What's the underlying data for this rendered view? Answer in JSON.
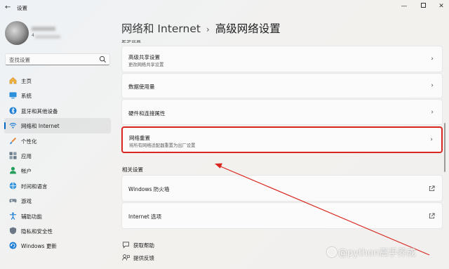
{
  "window": {
    "title": "设置",
    "back": "←",
    "minimize": "—",
    "close": "✕"
  },
  "user": {
    "email_prefix": "4"
  },
  "search": {
    "placeholder": "查找设置"
  },
  "sidebar": {
    "items": [
      {
        "label": "主页",
        "icon": "home-icon"
      },
      {
        "label": "系统",
        "icon": "system-icon"
      },
      {
        "label": "蓝牙和其他设备",
        "icon": "bluetooth-icon"
      },
      {
        "label": "网络和 Internet",
        "icon": "wifi-icon",
        "active": true
      },
      {
        "label": "个性化",
        "icon": "brush-icon"
      },
      {
        "label": "应用",
        "icon": "apps-icon"
      },
      {
        "label": "帐户",
        "icon": "account-icon"
      },
      {
        "label": "时间和语言",
        "icon": "globe-clock-icon"
      },
      {
        "label": "游戏",
        "icon": "gamepad-icon"
      },
      {
        "label": "辅助功能",
        "icon": "accessibility-icon"
      },
      {
        "label": "隐私和安全性",
        "icon": "shield-icon"
      },
      {
        "label": "Windows 更新",
        "icon": "update-icon"
      }
    ]
  },
  "breadcrumb": {
    "parent": "网络和 Internet",
    "separator": "›",
    "current": "高级网络设置"
  },
  "partial_section": "更多设置",
  "cards": [
    {
      "title": "高级共享设置",
      "subtitle": "更改网络共享设置",
      "chevron": "›"
    },
    {
      "title": "数据使用量",
      "chevron": "›"
    },
    {
      "title": "硬件和连接属性",
      "chevron": "›"
    },
    {
      "title": "网络重置",
      "subtitle": "将所有网络适配器重置为出厂设置",
      "chevron": "›"
    }
  ],
  "related": {
    "label": "相关设置",
    "items": [
      {
        "title": "Windows 防火墙",
        "icon": "external-link-icon"
      },
      {
        "title": "Internet 选项",
        "icon": "external-link-icon"
      }
    ]
  },
  "help": {
    "get_help": "获取帮助",
    "feedback": "提供反馈"
  },
  "watermark": "@python高手养成",
  "colors": {
    "accent": "#0067c0",
    "highlight_border": "#d9271f",
    "arrow": "#d9271f"
  }
}
